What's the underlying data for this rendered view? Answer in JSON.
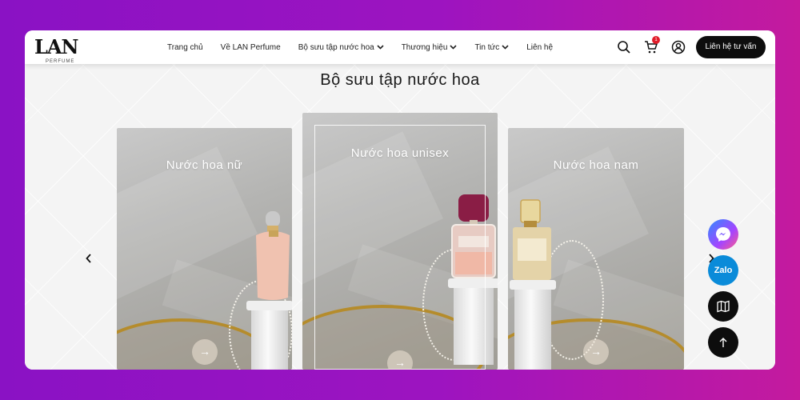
{
  "brand": {
    "logo_text": "LAN",
    "logo_sub": "PERFUME"
  },
  "nav": {
    "items": [
      {
        "label": "Trang chủ",
        "has_dropdown": false
      },
      {
        "label": "Về LAN Perfume",
        "has_dropdown": false
      },
      {
        "label": "Bộ sưu tập nước hoa",
        "has_dropdown": true
      },
      {
        "label": "Thương hiệu",
        "has_dropdown": true
      },
      {
        "label": "Tin tức",
        "has_dropdown": true
      },
      {
        "label": "Liên hệ",
        "has_dropdown": false
      }
    ]
  },
  "header_actions": {
    "search_icon": "search-icon",
    "cart_icon": "cart-icon",
    "cart_count": "1",
    "account_icon": "user-icon",
    "contact_button": "Liên hệ tư vấn"
  },
  "section": {
    "title": "Bộ sưu tập nước hoa"
  },
  "collections": [
    {
      "title": "Nước hoa nữ",
      "arrow": "→"
    },
    {
      "title": "Nước hoa unisex",
      "arrow": "→"
    },
    {
      "title": "Nước hoa nam",
      "arrow": "→"
    }
  ],
  "carousel": {
    "prev": "‹",
    "next": "›"
  },
  "floating": [
    {
      "name": "messenger",
      "label": "",
      "color": "#7b5cff"
    },
    {
      "name": "zalo",
      "label": "Zalo",
      "color": "#0a8bd9"
    },
    {
      "name": "map",
      "label": "",
      "color": "#0d0d0d"
    },
    {
      "name": "back-to-top",
      "label": "",
      "color": "#0d0d0d"
    }
  ],
  "colors": {
    "accent": "#0d0d0d",
    "badge": "#e11d2a",
    "background_gradient_start": "#8a12c4",
    "background_gradient_end": "#c41a9e"
  }
}
